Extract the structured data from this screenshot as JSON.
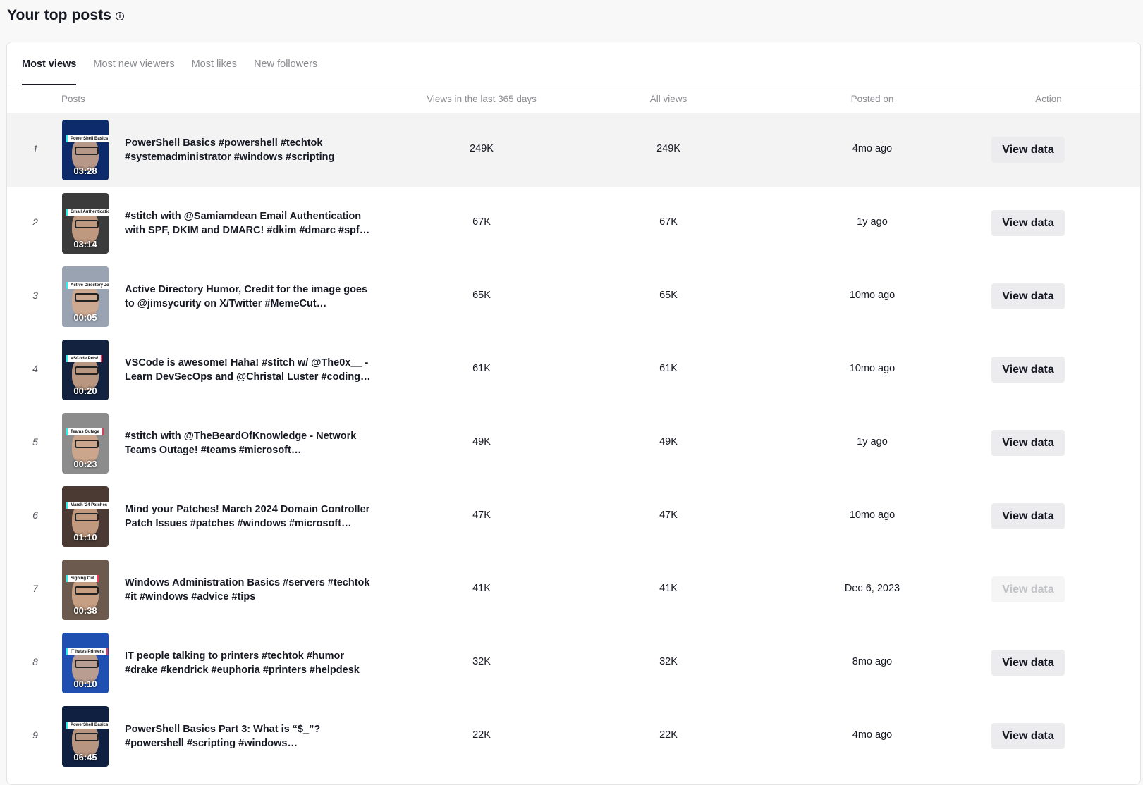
{
  "header": {
    "title": "Your top posts",
    "info_icon": "info-icon"
  },
  "tabs": [
    {
      "label": "Most views",
      "active": true
    },
    {
      "label": "Most new viewers",
      "active": false
    },
    {
      "label": "Most likes",
      "active": false
    },
    {
      "label": "New followers",
      "active": false
    }
  ],
  "columns": {
    "posts": "Posts",
    "views_365": "Views in the last 365 days",
    "all_views": "All views",
    "posted_on": "Posted on",
    "action": "Action"
  },
  "rows": [
    {
      "rank": "1",
      "duration": "03:28",
      "thumb_label": "PowerShell Basics",
      "thumb_color": "#0d2a6b",
      "title": "PowerShell Basics #powershell #techtok #systemadministrator #windows #scripting",
      "views_365": "249K",
      "all_views": "249K",
      "posted": "4mo ago",
      "action": "View data",
      "action_enabled": true
    },
    {
      "rank": "2",
      "duration": "03:14",
      "thumb_label": "Email Authentication",
      "thumb_color": "#3b3b3b",
      "title": "#stitch with @Samiamdean Email Authentication with SPF, DKIM and DMARC! #dkim #dmarc #spf…",
      "views_365": "67K",
      "all_views": "67K",
      "posted": "1y ago",
      "action": "View data",
      "action_enabled": true
    },
    {
      "rank": "3",
      "duration": "00:05",
      "thumb_label": "Active Directory Jokes",
      "thumb_color": "#9aa3b2",
      "title": "Active Directory Humor, Credit for the image goes to @jimsycurity on X/Twitter #MemeCut…",
      "views_365": "65K",
      "all_views": "65K",
      "posted": "10mo ago",
      "action": "View data",
      "action_enabled": true
    },
    {
      "rank": "4",
      "duration": "00:20",
      "thumb_label": "VSCode Pets!",
      "thumb_color": "#13233f",
      "title": "VSCode is awesome! Haha! #stitch w/ @The0x__ - Learn DevSecOps and @Christal Luster #coding…",
      "views_365": "61K",
      "all_views": "61K",
      "posted": "10mo ago",
      "action": "View data",
      "action_enabled": true
    },
    {
      "rank": "5",
      "duration": "00:23",
      "thumb_label": "Teams Outage",
      "thumb_color": "#8c8c8c",
      "title": "#stitch with @TheBeardOfKnowledge - Network Teams Outage! #teams #microsoft #microsoftteam…",
      "views_365": "49K",
      "all_views": "49K",
      "posted": "1y ago",
      "action": "View data",
      "action_enabled": true
    },
    {
      "rank": "6",
      "duration": "01:10",
      "thumb_label": "March '24 Patches",
      "thumb_color": "#4a3a33",
      "title": "Mind your Patches! March 2024 Domain Controller Patch Issues #patches #windows #microsoft…",
      "views_365": "47K",
      "all_views": "47K",
      "posted": "10mo ago",
      "action": "View data",
      "action_enabled": true
    },
    {
      "rank": "7",
      "duration": "00:38",
      "thumb_label": "Signing Out",
      "thumb_color": "#6b5a4d",
      "title": "Windows Administration Basics #servers #techtok #it #windows #advice #tips",
      "views_365": "41K",
      "all_views": "41K",
      "posted": "Dec 6, 2023",
      "action": "View data",
      "action_enabled": false
    },
    {
      "rank": "8",
      "duration": "00:10",
      "thumb_label": "IT hates Printers",
      "thumb_color": "#1f4fb0",
      "title": "IT people talking to printers #techtok #humor #drake #kendrick #euphoria #printers #helpdesk",
      "views_365": "32K",
      "all_views": "32K",
      "posted": "8mo ago",
      "action": "View data",
      "action_enabled": true
    },
    {
      "rank": "9",
      "duration": "06:45",
      "thumb_label": "PowerShell Basics: What is $_?",
      "thumb_color": "#0f2040",
      "title": "PowerShell Basics Part 3: What is “$_”? #powershell #scripting #windows #systemadministrator #techtok",
      "views_365": "22K",
      "all_views": "22K",
      "posted": "4mo ago",
      "action": "View data",
      "action_enabled": true
    }
  ]
}
